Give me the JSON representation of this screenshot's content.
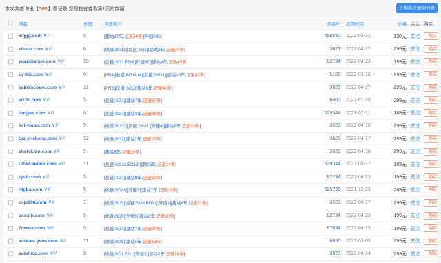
{
  "summary": {
    "prefix": "本次共查询出【",
    "count": "362",
    "suffix": "】条记录,您现在在查看第1页的数据"
  },
  "export_label": "下载此次查询列表",
  "headers": {
    "domain": "域名",
    "length": "长度",
    "intro": "域名简介",
    "id": "卖家ID",
    "time": "到期时间",
    "price": "价格",
    "fav": "关注",
    "buy": "购买"
  },
  "labels": {
    "fav": "关注",
    "buy": "购买",
    "v": "V",
    "p": "P"
  },
  "rows": [
    {
      "domain": "xsjgg.com",
      "length": "5",
      "intro": "[建站17年,",
      "rec": "记录84条",
      "intro2": "][伴随280]",
      "id": "458590",
      "time": "2022-03-21",
      "price": "130元"
    },
    {
      "domain": "sfncat.com",
      "length": "6",
      "intro": "[收录:BD18][反链:SG1][建站3年,",
      "rec": "记录27条",
      "intro2": "]",
      "id": "3623",
      "time": "2022-04-27",
      "price": "299元"
    },
    {
      "domain": "yuandianpx.com",
      "length": "10",
      "intro": "[反链:SG1,BD6][外链67][建站4年,",
      "rec": "记录45条",
      "intro2": "]",
      "id": "92734",
      "time": "2022-04-23",
      "price": "199元"
    },
    {
      "domain": "Ly-bio.com",
      "length": "6",
      "intro": "[PR4][收录:BD1614][反链:SG11][建站10年,",
      "rec": "记录42条",
      "intro2": "]",
      "id": "5166",
      "time": "2022-03-16",
      "price": "299元"
    },
    {
      "domain": "saitdiscover.com",
      "length": "12",
      "intro": "[PR3][反链:SG2][建站6年,",
      "rec": "记录40条",
      "intro2": "]",
      "id": "3623",
      "time": "2022-04-27",
      "price": "299元"
    },
    {
      "domain": "wz-tc.com",
      "length": "5",
      "intro": "[反链:SG1][建站7年,",
      "rec": "记录37条",
      "intro2": "]",
      "id": "6000",
      "time": "2022-01-20",
      "price": "299元"
    },
    {
      "domain": "hnrjpm.com",
      "length": "6",
      "intro": "[反链:SG3][建站4年,",
      "rec": "记录36条",
      "intro2": "]",
      "id": "529344",
      "time": "2021-07-11",
      "price": "188元"
    },
    {
      "domain": "ksf-water.com",
      "length": "9",
      "intro": "[收录:BD37][反链:SG11][外链4][建站8年,",
      "rec": "记录33条",
      "intro2": "]",
      "id": "3623",
      "time": "2022-04-18",
      "price": "299元"
    },
    {
      "domain": "bai-yi-sheng.com",
      "length": "12",
      "intro": "[收录:BD2][建站7年,",
      "rec": "记录27条",
      "intro2": "]",
      "id": "3623",
      "time": "2022-04-17",
      "price": "299元"
    },
    {
      "domain": "shshiLian.com",
      "length": "9",
      "intro": "[建站8年,",
      "rec": "记录26条",
      "intro2": "]",
      "id": "3623",
      "time": "2022-04-18",
      "price": "299元"
    },
    {
      "domain": "Liber-aedon.com",
      "length": "11",
      "intro": "[反链:SG12,BD13][建站5年,",
      "rec": "记录24条",
      "intro2": "]",
      "id": "529344",
      "time": "2022-03-17",
      "price": "188元"
    },
    {
      "domain": "bjofc.com",
      "length": "5",
      "intro": "[反链:SG1][建站8年,",
      "rec": "记录23条",
      "intro2": "]",
      "id": "92734",
      "time": "2022-04-23",
      "price": "199元"
    },
    {
      "domain": "ntgLs.com",
      "length": "5",
      "intro": "[收录:BD88][外链1][建站7年,",
      "rec": "记录21条",
      "intro2": "]",
      "id": "525796",
      "time": "2021-12-23",
      "price": "288元"
    },
    {
      "domain": "cxjx998.com",
      "length": "7",
      "intro": "[收录:BD5][反链:SG8,BD11][外链1][建站6年,",
      "rec": "记录21条",
      "intro2": "]",
      "id": "3623",
      "time": "2022-03-17",
      "price": "299元"
    },
    {
      "domain": "sxsxrh.com",
      "length": "6",
      "intro": "[收录:BD5][外链8][建站8年,",
      "rec": "记录20条",
      "intro2": "]",
      "id": "92734",
      "time": "2022-04-23",
      "price": "199元"
    },
    {
      "domain": "7mwsz.com",
      "length": "5",
      "intro": "[反链:SG1][建站7年,",
      "rec": "记录20条",
      "intro2": "]",
      "id": "87834",
      "time": "2022-04-15",
      "price": "199元"
    },
    {
      "domain": "koreaeLysee.com",
      "length": "11",
      "intro": "[收录:BD6][建站5年,",
      "rec": "记录18条",
      "intro2": "]",
      "id": "6655",
      "time": "2022-03-03",
      "price": "299元"
    },
    {
      "domain": "saishicd.com",
      "length": "8",
      "intro": "[收录:BD1,SD1][外链1][建站2年,",
      "rec": "记录18条",
      "intro2": "]",
      "id": "3623",
      "time": "2022-04-14",
      "price": "299元"
    }
  ]
}
